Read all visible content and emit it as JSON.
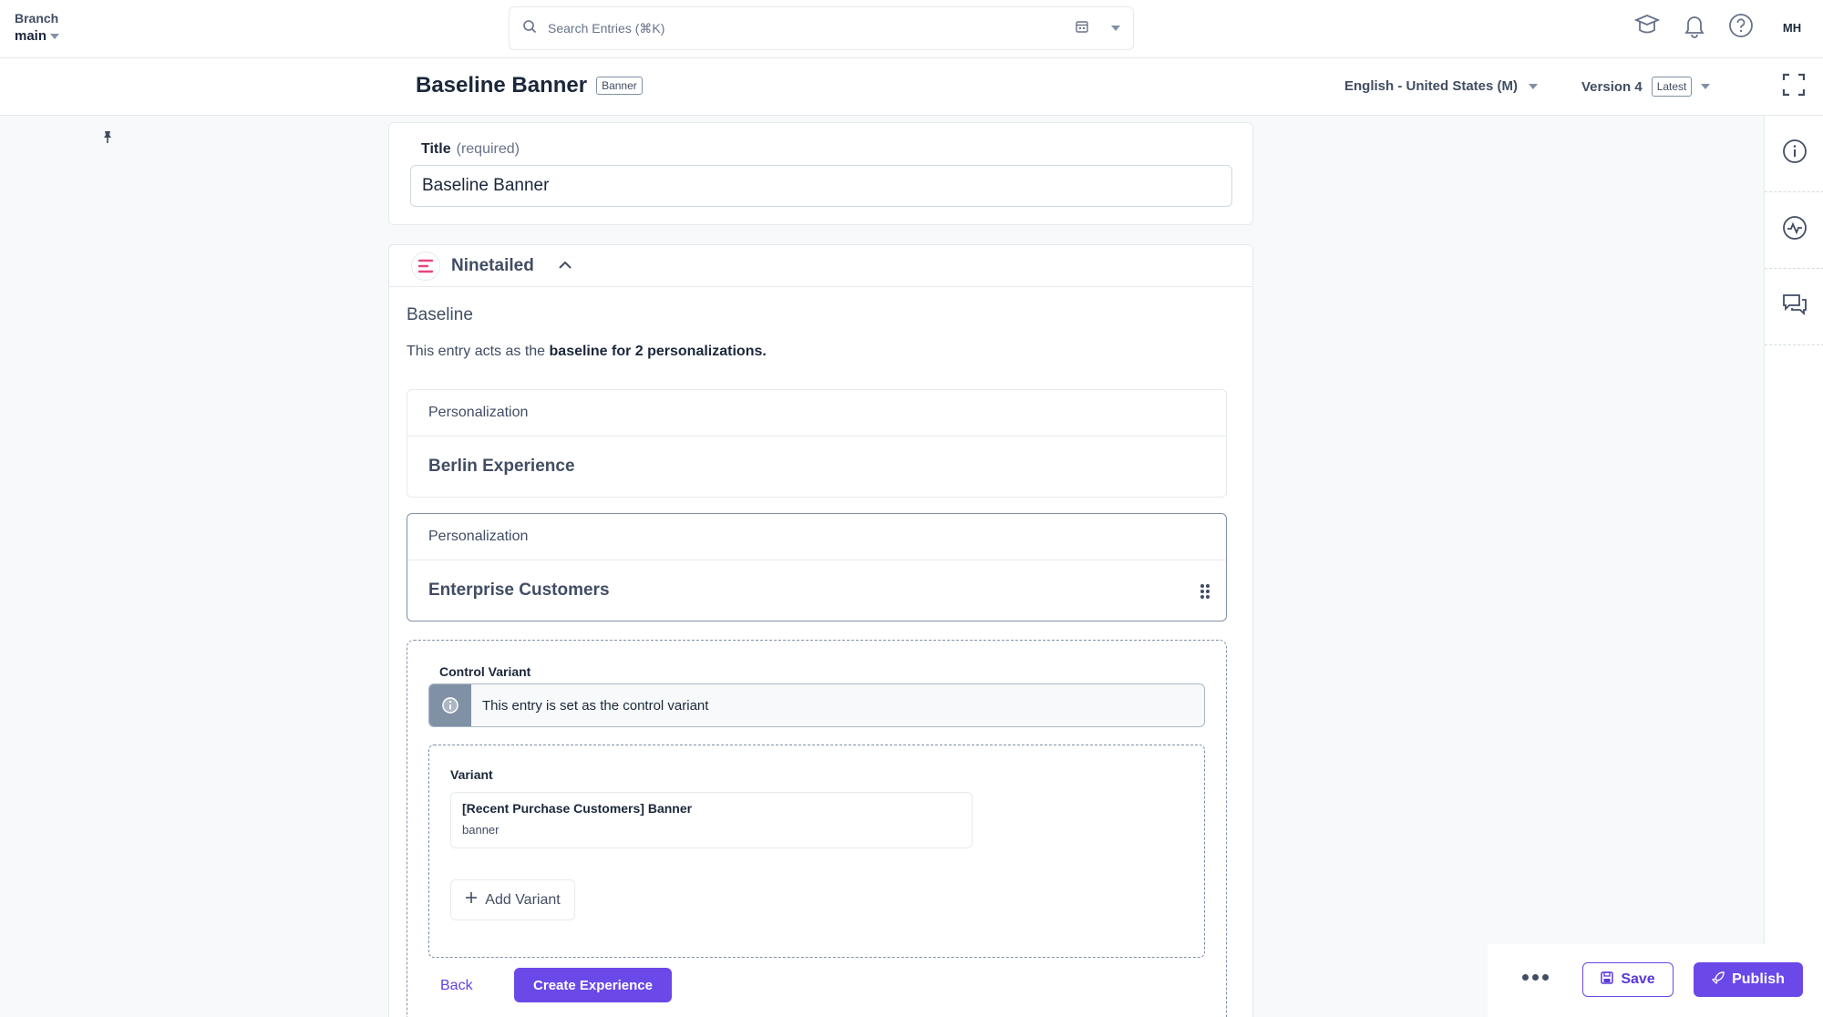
{
  "branch": {
    "label": "Branch",
    "value": "main"
  },
  "search": {
    "placeholder": "Search Entries (⌘K)"
  },
  "user": {
    "initials": "MH"
  },
  "entry": {
    "title": "Baseline Banner",
    "content_type": "Banner",
    "locale": "English - United States (M)",
    "version": "Version 4",
    "version_badge": "Latest"
  },
  "title_field": {
    "label": "Title",
    "required": "(required)",
    "value": "Baseline Banner"
  },
  "ninetailed": {
    "name": "Ninetailed",
    "heading": "Baseline",
    "desc_prefix": "This entry acts as the ",
    "desc_bold": "baseline for 2 personalizations.",
    "personalizations": [
      {
        "label": "Personalization",
        "name": "Berlin Experience"
      },
      {
        "label": "Personalization",
        "name": "Enterprise Customers"
      }
    ],
    "control_label": "Control Variant",
    "control_note": "This entry is set as the control variant",
    "variant_label": "Variant",
    "variant_entry_title": "[Recent Purchase Customers] Banner",
    "variant_entry_type": "banner",
    "add_variant": "Add Variant",
    "back": "Back",
    "create": "Create Experience"
  },
  "actions": {
    "save": "Save",
    "publish": "Publish"
  },
  "colors": {
    "accent": "#6b48e8",
    "text": "#1b273a",
    "muted": "#414d63",
    "border": "#e5ebed"
  }
}
